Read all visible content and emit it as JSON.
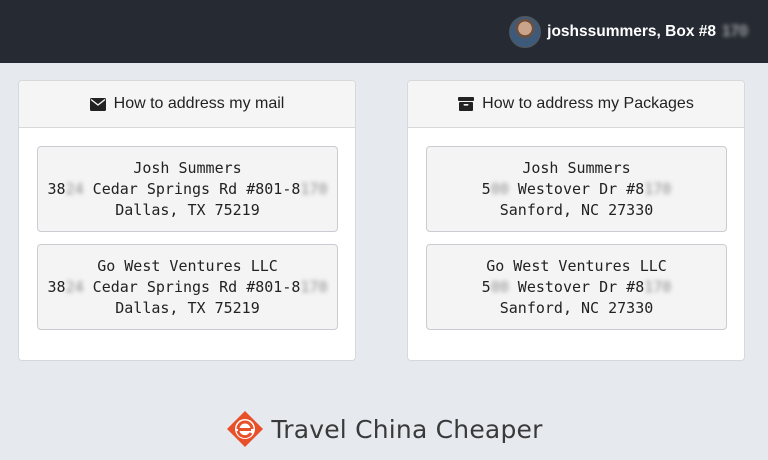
{
  "user": {
    "name_box": "joshssummers, Box #8",
    "box_redacted": "170"
  },
  "mail_card": {
    "title": "How to address my mail",
    "icon": "envelope-icon",
    "addresses": [
      {
        "line1": "Josh Summers",
        "line2_prefix": "38",
        "line2_redacted": "24",
        "line2_mid": " Cedar Springs Rd #801-8",
        "line2_redacted_end": "170",
        "line3": "Dallas, TX 75219"
      },
      {
        "line1": "Go West Ventures LLC",
        "line2_prefix": "38",
        "line2_redacted": "24",
        "line2_mid": " Cedar Springs Rd #801-8",
        "line2_redacted_end": "170",
        "line3": "Dallas, TX 75219"
      }
    ]
  },
  "packages_card": {
    "title": "How to address my Packages",
    "icon": "archive-box-icon",
    "addresses": [
      {
        "line1": "Josh Summers",
        "line2_prefix": "5",
        "line2_redacted": "00",
        "line2_mid": " Westover Dr #8",
        "line2_redacted_end": "170",
        "line3": "Sanford, NC 27330"
      },
      {
        "line1": "Go West Ventures LLC",
        "line2_prefix": "5",
        "line2_redacted": "00",
        "line2_mid": " Westover Dr #8",
        "line2_redacted_end": "170",
        "line3": "Sanford, NC 27330"
      }
    ]
  },
  "footer": {
    "brand": "Travel China Cheaper",
    "logo_color": "#e8502a"
  }
}
